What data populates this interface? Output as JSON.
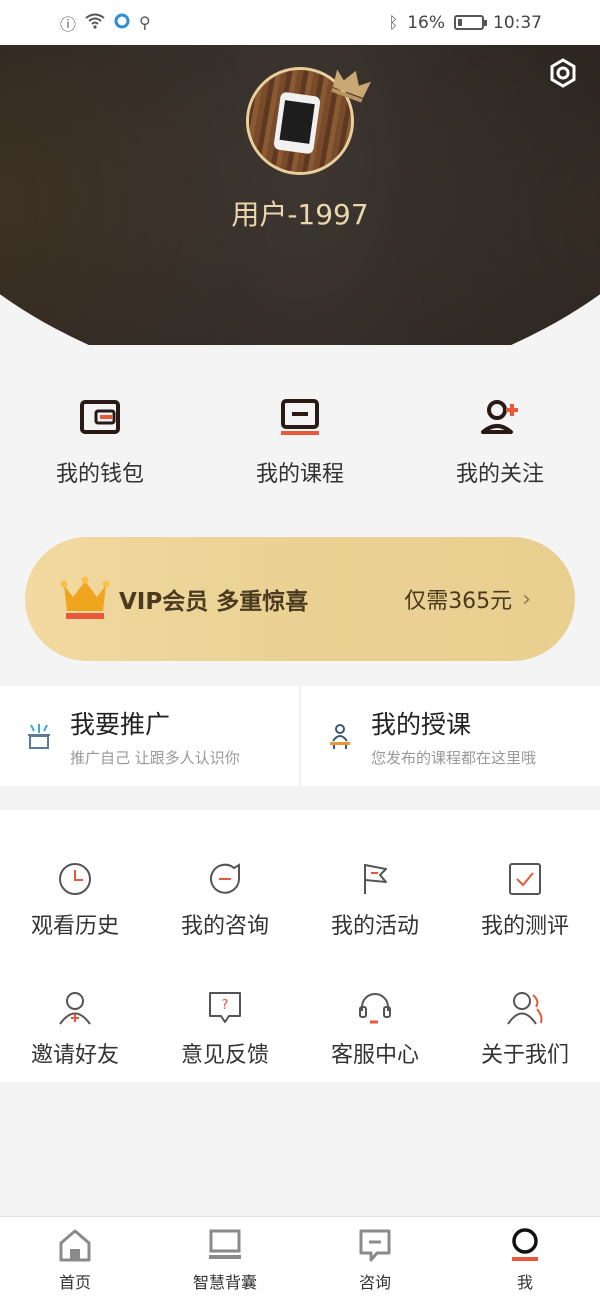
{
  "status_bar": {
    "battery": "16%",
    "time": "10:37"
  },
  "profile": {
    "username": "用户-1997"
  },
  "quick_actions": [
    {
      "label": "我的钱包",
      "icon": "wallet-icon"
    },
    {
      "label": "我的课程",
      "icon": "course-icon"
    },
    {
      "label": "我的关注",
      "icon": "follow-icon"
    }
  ],
  "vip": {
    "title": "VIP会员 多重惊喜",
    "price": "仅需365元"
  },
  "promo": [
    {
      "title": "我要推广",
      "subtitle": "推广自己 让跟多人认识你"
    },
    {
      "title": "我的授课",
      "subtitle": "您发布的课程都在这里哦"
    }
  ],
  "grid": [
    {
      "label": "观看历史",
      "icon": "clock-icon"
    },
    {
      "label": "我的咨询",
      "icon": "consult-icon"
    },
    {
      "label": "我的活动",
      "icon": "flag-icon"
    },
    {
      "label": "我的测评",
      "icon": "checkbox-icon"
    },
    {
      "label": "邀请好友",
      "icon": "invite-icon"
    },
    {
      "label": "意见反馈",
      "icon": "feedback-icon"
    },
    {
      "label": "客服中心",
      "icon": "headset-icon"
    },
    {
      "label": "关于我们",
      "icon": "about-icon"
    }
  ],
  "tabbar": [
    {
      "label": "首页",
      "icon": "home-icon"
    },
    {
      "label": "智慧背囊",
      "icon": "laptop-icon"
    },
    {
      "label": "咨询",
      "icon": "chat-icon"
    },
    {
      "label": "我",
      "icon": "profile-icon"
    }
  ],
  "colors": {
    "accent": "#e8583a",
    "gold": "#ead193",
    "icon": "#333333"
  }
}
